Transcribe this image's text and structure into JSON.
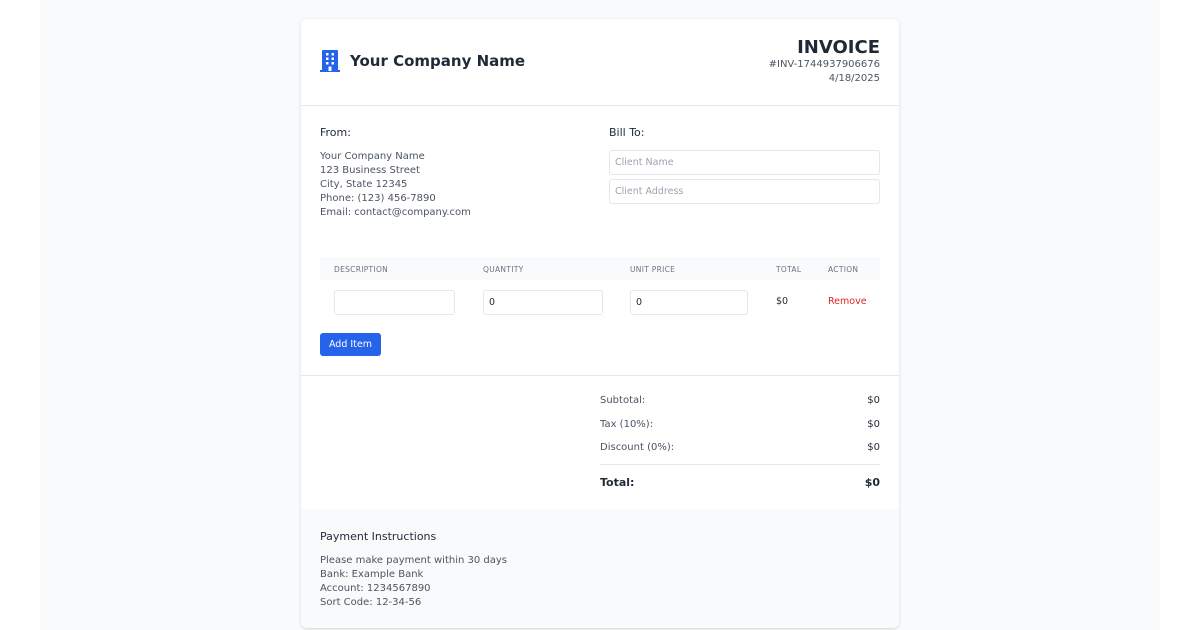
{
  "header": {
    "company_name": "Your Company Name",
    "title": "INVOICE",
    "invoice_number": "#INV-1744937906676",
    "date": "4/18/2025"
  },
  "from": {
    "label": "From:",
    "lines": [
      "Your Company Name",
      "123 Business Street",
      "City, State 12345",
      "Phone: (123) 456-7890",
      "Email: contact@company.com"
    ]
  },
  "bill_to": {
    "label": "Bill To:",
    "client_name": {
      "value": "",
      "placeholder": "Client Name"
    },
    "client_address": {
      "value": "",
      "placeholder": "Client Address"
    }
  },
  "items_table": {
    "headers": [
      "DESCRIPTION",
      "QUANTITY",
      "UNIT PRICE",
      "TOTAL",
      "ACTION"
    ],
    "rows": [
      {
        "description": "",
        "quantity": "0",
        "unit_price": "0",
        "total": "$0",
        "action": "Remove"
      }
    ],
    "add_item_label": "Add Item"
  },
  "totals": {
    "subtotal_label": "Subtotal:",
    "subtotal": "$0",
    "tax_label": "Tax (10%):",
    "tax": "$0",
    "discount_label": "Discount (0%):",
    "discount": "$0",
    "total_label": "Total:",
    "total": "$0"
  },
  "payment": {
    "title": "Payment Instructions",
    "lines": [
      "Please make payment within 30 days",
      "Bank: Example Bank",
      "Account: 1234567890",
      "Sort Code: 12-34-56"
    ]
  },
  "colors": {
    "accent": "#2563eb",
    "danger": "#dc2626",
    "page_background": "#f9fafb"
  },
  "icons": {
    "logo": "building-icon"
  }
}
